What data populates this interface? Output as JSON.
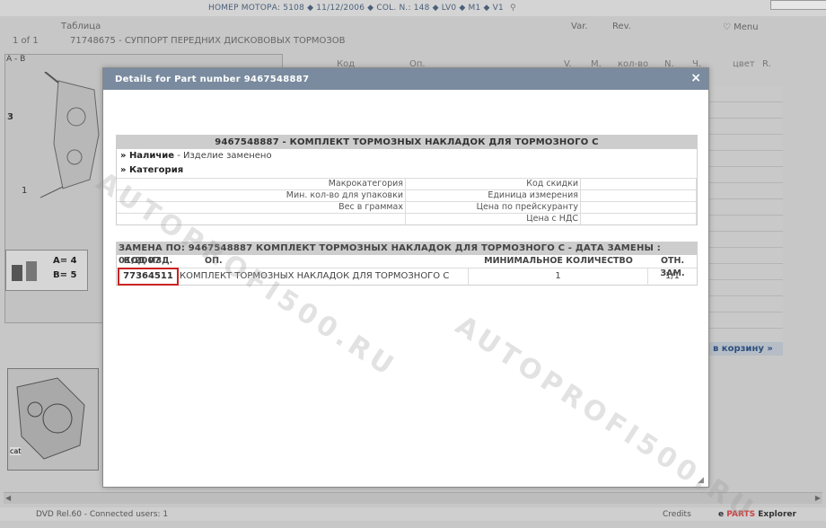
{
  "background": {
    "motor_info": "НОМЕР МОТОРА: 5108 ◆ 11/12/2006 ◆ COL. N.: 148 ◆ LV0 ◆ M1 ◆ V1",
    "header": {
      "table_label": "Таблица",
      "page": "1 of 1",
      "table_title": "71748675 - СУППОРТ ПЕРЕДНИХ ДИСКОВОВЫХ ТОРМОЗОВ",
      "var_label": "Var.",
      "rev_label": "Rev.",
      "menu_label": "♡ Menu"
    },
    "ab_label": "A - B",
    "label_3": "3",
    "label_1": "1",
    "columns": [
      "Код",
      "Оп.",
      "V.",
      "M.",
      "кол-во",
      "N.",
      "Ч.",
      "цвет",
      "R."
    ],
    "ab_box": {
      "a": "A= 4",
      "b": "B= 5"
    },
    "cart_link": "в корзину »",
    "thumb_label": "cat"
  },
  "status_bar": {
    "left": "DVD Rel.60  -  Connected users: 1",
    "credits": "Credits",
    "brand_prefix": "e",
    "brand_parts": "PARTS",
    "brand_suffix": "Explorer"
  },
  "modal": {
    "title": "Details for Part number 9467548887",
    "close": "×",
    "part_heading": "9467548887 - КОМПЛЕКТ ТОРМОЗНЫХ НАКЛАДОК ДЛЯ ТОРМОЗНОГО С",
    "availability_label": "» Наличие",
    "availability_value": " - Изделие заменено",
    "category_label": "» Категория",
    "attributes": {
      "macro_category": "Макрокатегория",
      "discount_code": "Код скидки",
      "min_pack_qty": "Мин. кол-во для упаковки",
      "unit": "Единица измерения",
      "weight": "Вес в граммах",
      "list_price": "Цена по прейскуранту",
      "price_vat": "Цена с НДС"
    },
    "replacement": {
      "heading": "ЗАМЕНА ПО: 9467548887 КОМПЛЕКТ ТОРМОЗНЫХ НАКЛАДОК ДЛЯ ТОРМОЗНОГО С - ДАТА ЗАМЕНЫ : 01/2007",
      "columns": {
        "code": "КОД ИЗД.",
        "op": "ОП.",
        "min_qty": "МИНИМАЛЬНОЕ КОЛИЧЕСТВО",
        "rel": "ОТН. ЗАМ."
      },
      "rows": [
        {
          "code": "77364511",
          "desc": "КОМПЛЕКТ ТОРМОЗНЫХ НАКЛАДОК ДЛЯ ТОРМОЗНОГО С",
          "min_qty": "1",
          "rel": "1/1"
        }
      ]
    }
  },
  "watermark": "AUTOPROFI500.RU"
}
